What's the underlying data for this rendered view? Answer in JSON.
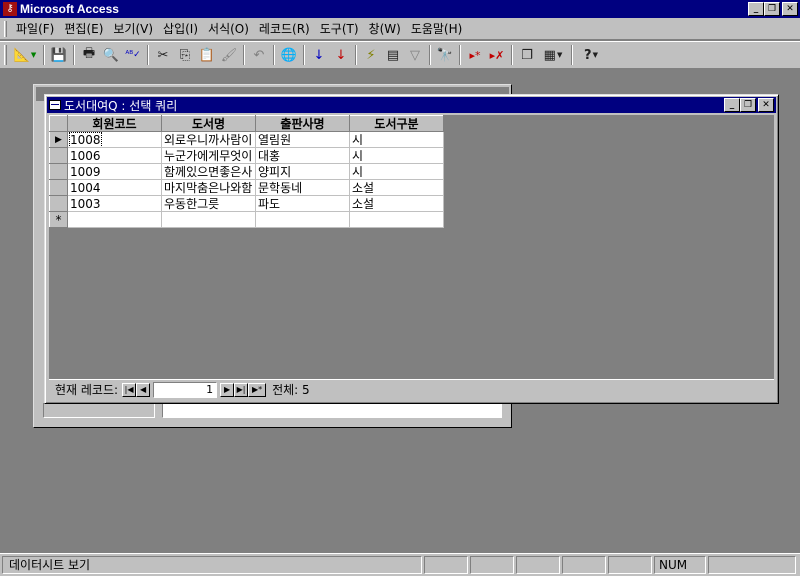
{
  "app": {
    "title": "Microsoft Access",
    "icon": "access-key-icon"
  },
  "window_buttons": {
    "minimize": "_",
    "restore": "❐",
    "close": "✕"
  },
  "menu": {
    "items": [
      {
        "label": "파일(F)"
      },
      {
        "label": "편집(E)"
      },
      {
        "label": "보기(V)"
      },
      {
        "label": "삽입(I)"
      },
      {
        "label": "서식(O)"
      },
      {
        "label": "레코드(R)"
      },
      {
        "label": "도구(T)"
      },
      {
        "label": "창(W)"
      },
      {
        "label": "도움말(H)"
      }
    ]
  },
  "toolbar": {
    "buttons": [
      {
        "name": "view-design-icon",
        "glyph": "📐"
      },
      {
        "name": "save-icon",
        "glyph": "💾"
      },
      {
        "name": "print-icon",
        "glyph": "🖶"
      },
      {
        "name": "print-preview-icon",
        "glyph": "🔍"
      },
      {
        "name": "spelling-icon",
        "glyph": "ᴬᴮ✓"
      },
      {
        "name": "cut-icon",
        "glyph": "✂"
      },
      {
        "name": "copy-icon",
        "glyph": "⎘"
      },
      {
        "name": "paste-icon",
        "glyph": "📋"
      },
      {
        "name": "format-painter-icon",
        "glyph": "🖌"
      },
      {
        "name": "undo-icon",
        "glyph": "↶"
      },
      {
        "name": "hyperlink-icon",
        "glyph": "🌐"
      },
      {
        "name": "sort-ascending-icon",
        "glyph": "↓"
      },
      {
        "name": "sort-descending-icon",
        "glyph": "↓"
      },
      {
        "name": "filter-by-selection-icon",
        "glyph": "⚡"
      },
      {
        "name": "filter-by-form-icon",
        "glyph": "▤"
      },
      {
        "name": "apply-filter-icon",
        "glyph": "▽"
      },
      {
        "name": "find-icon",
        "glyph": "🔭"
      },
      {
        "name": "new-record-icon",
        "glyph": "▸*"
      },
      {
        "name": "delete-record-icon",
        "glyph": "▸✗"
      },
      {
        "name": "database-window-icon",
        "glyph": "❐"
      },
      {
        "name": "new-object-icon",
        "glyph": "▦"
      },
      {
        "name": "help-icon",
        "glyph": "?"
      }
    ]
  },
  "query_window": {
    "title": "도서대여Q : 선택 쿼리",
    "columns": [
      "회원코드",
      "도서명",
      "출판사명",
      "도서구분"
    ],
    "rows": [
      [
        "1008",
        "외로우니까사람이",
        "열림원",
        "시"
      ],
      [
        "1006",
        "누군가에게무엇이",
        "대홍",
        "시"
      ],
      [
        "1009",
        "함께있으면좋은사",
        "양피지",
        "시"
      ],
      [
        "1004",
        "마지막춤은나와함",
        "문학동네",
        "소설"
      ],
      [
        "1003",
        "우동한그릇",
        "파도",
        "소설"
      ]
    ],
    "current_row_marker": "▶",
    "new_row_marker": "*",
    "navigation": {
      "label": "현재 레코드:",
      "current_record": "1",
      "total_label": "전체: 5",
      "first": "|◀",
      "prev": "◀",
      "next": "▶",
      "last": "▶|",
      "new": "▶*"
    }
  },
  "statusbar": {
    "text": "데이터시트 보기",
    "num": "NUM"
  }
}
